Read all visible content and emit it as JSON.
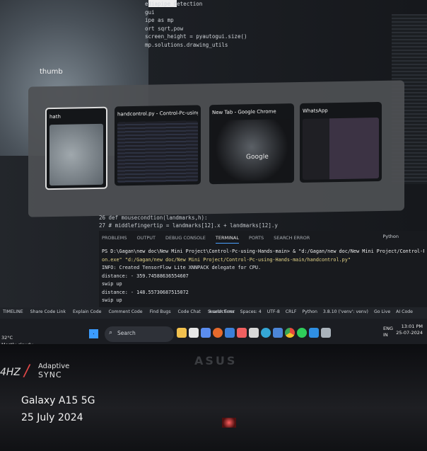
{
  "code_lines": [
    "ediapipe_detection",
    "",
    "gui",
    "ipe as mp",
    "",
    "ort sqrt,pow",
    "screen_height = pyautogui.size()",
    "",
    "mp.solutions.drawing_utils"
  ],
  "cam_label": "thumb",
  "switcher": {
    "windows": [
      {
        "title": "hath"
      },
      {
        "title": "handcontrol.py - Control-Pc-using-Hands-m..."
      },
      {
        "title": "New Tab - Google Chrome"
      },
      {
        "title": "WhatsApp"
      }
    ],
    "chrome_logo": "Google"
  },
  "editor": {
    "lines": [
      "26   def mousecondtion(landmarks,h):",
      "27       # middlefingertip = landmarks[12].x + landmarks[12].y"
    ]
  },
  "panel": {
    "tabs": [
      "PROBLEMS",
      "OUTPUT",
      "DEBUG CONSOLE",
      "TERMINAL",
      "PORTS",
      "SEARCH ERROR"
    ],
    "active_tab": "TERMINAL",
    "lang": "Python",
    "terminal": [
      "PS D:\\Gagan\\new doc\\New Mini Project\\Control-Pc-using-Hands-main> & \"d:/Gagan/new doc/New Mini Project/Control-Pc-using-Hands-main/.venv/Scripts/pyth",
      "on.exe\" \"d:/Gagan/new doc/New Mini Project/Control-Pc-using-Hands-main/handcontrol.py\"",
      "INFO: Created TensorFlow Lite XNNPACK delegate for CPU.",
      "distance: -  359.74588636554607",
      "swip up",
      "distance: -  148.55730687515072",
      "swip up"
    ]
  },
  "statusbar": {
    "left": [
      "TIMELINE",
      "Share Code Link",
      "Explain Code",
      "Comment Code",
      "Find Bugs",
      "Code Chat",
      "Search Error"
    ],
    "right": [
      "3 selections",
      "Spaces: 4",
      "UTF-8",
      "CRLF",
      "Python",
      "3.8.10 ('venv': venv)",
      "Go Live",
      "AI Code"
    ]
  },
  "taskbar": {
    "weather_temp": "32°C",
    "weather_desc": "Mostly cloudy",
    "search_placeholder": "Search",
    "lang_top": "ENG",
    "lang_bottom": "IN",
    "time": "13:01 PM",
    "date": "25-07-2024"
  },
  "laptop": {
    "brand": "ASUS",
    "hz": "4HZ",
    "adaptive": "Adaptive",
    "sync": "SYNC"
  },
  "watermark": {
    "model": "Galaxy A15 5G",
    "date": "25 July 2024"
  },
  "colors": {
    "accent": "#4aa0ff",
    "sync_red": "#e04848"
  }
}
